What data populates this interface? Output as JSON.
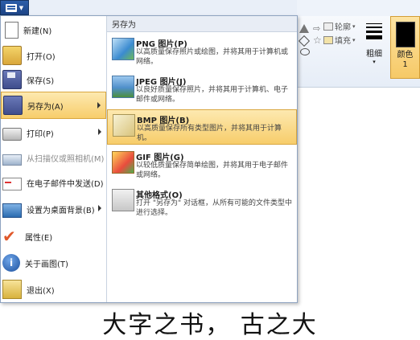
{
  "ribbon": {
    "outline_label": "轮廓",
    "fill_label": "填充",
    "size_label": "粗细",
    "color_label": "颜色 1",
    "color_value": "#000000"
  },
  "menu": {
    "items": [
      {
        "label": "新建(N)",
        "icon": "new-file-icon"
      },
      {
        "label": "打开(O)",
        "icon": "open-folder-icon"
      },
      {
        "label": "保存(S)",
        "icon": "save-icon"
      },
      {
        "label": "另存为(A)",
        "icon": "save-as-icon"
      },
      {
        "label": "打印(P)",
        "icon": "printer-icon"
      },
      {
        "label": "从扫描仪或照相机(M)",
        "icon": "scanner-icon"
      },
      {
        "label": "在电子邮件中发送(D)",
        "icon": "email-icon"
      },
      {
        "label": "设置为桌面背景(B)",
        "icon": "desktop-icon"
      },
      {
        "label": "属性(E)",
        "icon": "checkmark-icon"
      },
      {
        "label": "关于画图(T)",
        "icon": "info-icon"
      },
      {
        "label": "退出(X)",
        "icon": "exit-icon"
      }
    ]
  },
  "saveas": {
    "header": "另存为",
    "options": [
      {
        "title": "PNG 图片(P)",
        "desc": "以高质量保存照片或绘图，并将其用于计算机或网络。"
      },
      {
        "title": "JPEG 图片(J)",
        "desc": "以良好质量保存照片，并将其用于计算机、电子邮件或网络。"
      },
      {
        "title": "BMP 图片(B)",
        "desc": "以高质量保存所有类型图片，并将其用于计算机。"
      },
      {
        "title": "GIF 图片(G)",
        "desc": "以较低质量保存简单绘图，并将其用于电子邮件或网络。"
      },
      {
        "title": "其他格式(O)",
        "desc": "打开 \"另存为\" 对话框，从所有可能的文件类型中进行选择。"
      }
    ]
  },
  "caption": "大字之书， 古之大"
}
